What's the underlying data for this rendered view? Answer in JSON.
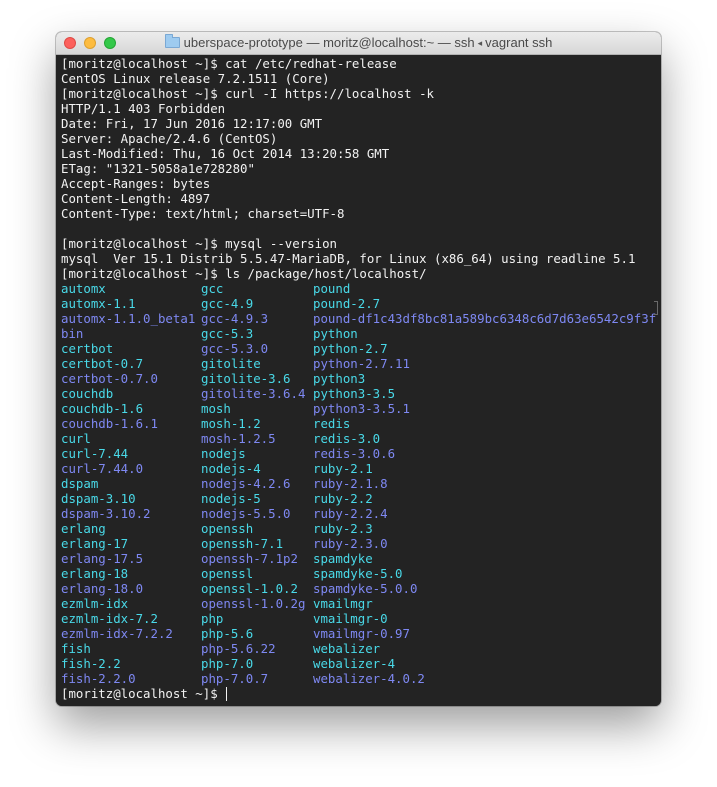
{
  "window": {
    "title_prefix": "uberspace-prototype — moritz@localhost:~ — ssh",
    "title_chevron": "◂",
    "title_suffix": "vagrant ssh",
    "colors": {
      "terminal_bg": "#232323",
      "text": "#f2f2f2",
      "directory": "#49d9e8",
      "symlink": "#7e88f2"
    }
  },
  "terminal": {
    "lines_before_listing": [
      "[moritz@localhost ~]$ cat /etc/redhat-release",
      "CentOS Linux release 7.2.1511 (Core)",
      "[moritz@localhost ~]$ curl -I https://localhost -k",
      "HTTP/1.1 403 Forbidden",
      "Date: Fri, 17 Jun 2016 12:17:00 GMT",
      "Server: Apache/2.4.6 (CentOS)",
      "Last-Modified: Thu, 16 Oct 2014 13:20:58 GMT",
      "ETag: \"1321-5058a1e728280\"",
      "Accept-Ranges: bytes",
      "Content-Length: 4897",
      "Content-Type: text/html; charset=UTF-8",
      "",
      "[moritz@localhost ~]$ mysql --version",
      "mysql  Ver 15.1 Distrib 5.5.47-MariaDB, for Linux (x86_64) using readline 5.1",
      "[moritz@localhost ~]$ ls /package/host/localhost/"
    ],
    "listing": [
      [
        {
          "name": "automx",
          "type": "dir"
        },
        {
          "name": "automx-1.1",
          "type": "dir"
        },
        {
          "name": "automx-1.1.0_beta1",
          "type": "link"
        },
        {
          "name": "bin",
          "type": "link"
        },
        {
          "name": "certbot",
          "type": "dir"
        },
        {
          "name": "certbot-0.7",
          "type": "dir"
        },
        {
          "name": "certbot-0.7.0",
          "type": "link"
        },
        {
          "name": "couchdb",
          "type": "dir"
        },
        {
          "name": "couchdb-1.6",
          "type": "dir"
        },
        {
          "name": "couchdb-1.6.1",
          "type": "link"
        },
        {
          "name": "curl",
          "type": "dir"
        },
        {
          "name": "curl-7.44",
          "type": "dir"
        },
        {
          "name": "curl-7.44.0",
          "type": "link"
        },
        {
          "name": "dspam",
          "type": "dir"
        },
        {
          "name": "dspam-3.10",
          "type": "dir"
        },
        {
          "name": "dspam-3.10.2",
          "type": "link"
        },
        {
          "name": "erlang",
          "type": "dir"
        },
        {
          "name": "erlang-17",
          "type": "dir"
        },
        {
          "name": "erlang-17.5",
          "type": "link"
        },
        {
          "name": "erlang-18",
          "type": "dir"
        },
        {
          "name": "erlang-18.0",
          "type": "link"
        },
        {
          "name": "ezmlm-idx",
          "type": "dir"
        },
        {
          "name": "ezmlm-idx-7.2",
          "type": "dir"
        },
        {
          "name": "ezmlm-idx-7.2.2",
          "type": "link"
        },
        {
          "name": "fish",
          "type": "dir"
        },
        {
          "name": "fish-2.2",
          "type": "dir"
        },
        {
          "name": "fish-2.2.0",
          "type": "link"
        }
      ],
      [
        {
          "name": "gcc",
          "type": "dir"
        },
        {
          "name": "gcc-4.9",
          "type": "dir"
        },
        {
          "name": "gcc-4.9.3",
          "type": "link"
        },
        {
          "name": "gcc-5.3",
          "type": "dir"
        },
        {
          "name": "gcc-5.3.0",
          "type": "link"
        },
        {
          "name": "gitolite",
          "type": "dir"
        },
        {
          "name": "gitolite-3.6",
          "type": "dir"
        },
        {
          "name": "gitolite-3.6.4",
          "type": "link"
        },
        {
          "name": "mosh",
          "type": "dir"
        },
        {
          "name": "mosh-1.2",
          "type": "dir"
        },
        {
          "name": "mosh-1.2.5",
          "type": "link"
        },
        {
          "name": "nodejs",
          "type": "dir"
        },
        {
          "name": "nodejs-4",
          "type": "dir"
        },
        {
          "name": "nodejs-4.2.6",
          "type": "link"
        },
        {
          "name": "nodejs-5",
          "type": "dir"
        },
        {
          "name": "nodejs-5.5.0",
          "type": "link"
        },
        {
          "name": "openssh",
          "type": "dir"
        },
        {
          "name": "openssh-7.1",
          "type": "dir"
        },
        {
          "name": "openssh-7.1p2",
          "type": "link"
        },
        {
          "name": "openssl",
          "type": "dir"
        },
        {
          "name": "openssl-1.0.2",
          "type": "dir"
        },
        {
          "name": "openssl-1.0.2g",
          "type": "link"
        },
        {
          "name": "php",
          "type": "dir"
        },
        {
          "name": "php-5.6",
          "type": "dir"
        },
        {
          "name": "php-5.6.22",
          "type": "link"
        },
        {
          "name": "php-7.0",
          "type": "dir"
        },
        {
          "name": "php-7.0.7",
          "type": "link"
        }
      ],
      [
        {
          "name": "pound",
          "type": "dir"
        },
        {
          "name": "pound-2.7",
          "type": "dir"
        },
        {
          "name": "pound-df1c43df8bc81a589bc6348c6d7d63e6542c9f3f",
          "type": "link"
        },
        {
          "name": "python",
          "type": "dir"
        },
        {
          "name": "python-2.7",
          "type": "dir"
        },
        {
          "name": "python-2.7.11",
          "type": "link"
        },
        {
          "name": "python3",
          "type": "dir"
        },
        {
          "name": "python3-3.5",
          "type": "dir"
        },
        {
          "name": "python3-3.5.1",
          "type": "link"
        },
        {
          "name": "redis",
          "type": "dir"
        },
        {
          "name": "redis-3.0",
          "type": "dir"
        },
        {
          "name": "redis-3.0.6",
          "type": "link"
        },
        {
          "name": "ruby-2.1",
          "type": "dir"
        },
        {
          "name": "ruby-2.1.8",
          "type": "link"
        },
        {
          "name": "ruby-2.2",
          "type": "dir"
        },
        {
          "name": "ruby-2.2.4",
          "type": "link"
        },
        {
          "name": "ruby-2.3",
          "type": "dir"
        },
        {
          "name": "ruby-2.3.0",
          "type": "link"
        },
        {
          "name": "spamdyke",
          "type": "dir"
        },
        {
          "name": "spamdyke-5.0",
          "type": "dir"
        },
        {
          "name": "spamdyke-5.0.0",
          "type": "link"
        },
        {
          "name": "vmailmgr",
          "type": "dir"
        },
        {
          "name": "vmailmgr-0",
          "type": "dir"
        },
        {
          "name": "vmailmgr-0.97",
          "type": "link"
        },
        {
          "name": "webalizer",
          "type": "dir"
        },
        {
          "name": "webalizer-4",
          "type": "dir"
        },
        {
          "name": "webalizer-4.0.2",
          "type": "link"
        }
      ]
    ],
    "final_prompt": "[moritz@localhost ~]$ "
  }
}
